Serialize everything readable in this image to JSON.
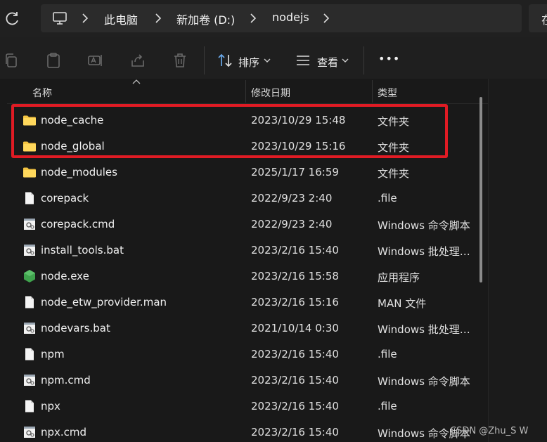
{
  "address": {
    "crumbs": [
      "此电脑",
      "新加卷 (D:)",
      "nodejs"
    ],
    "search_stub": "在"
  },
  "toolbar": {
    "sort_label": "排序",
    "view_label": "查看",
    "more_label": "•••"
  },
  "columns": {
    "name": "名称",
    "date": "修改日期",
    "type": "类型"
  },
  "files": [
    {
      "name": "node_cache",
      "date": "2023/10/29 15:48",
      "type": "文件夹",
      "icon": "folder-icon"
    },
    {
      "name": "node_global",
      "date": "2023/10/29 15:16",
      "type": "文件夹",
      "icon": "folder-icon"
    },
    {
      "name": "node_modules",
      "date": "2025/1/17 16:59",
      "type": "文件夹",
      "icon": "folder-icon"
    },
    {
      "name": "corepack",
      "date": "2022/9/23 2:40",
      "type": ".file",
      "icon": "file-icon"
    },
    {
      "name": "corepack.cmd",
      "date": "2022/9/23 2:40",
      "type": "Windows 命令脚本",
      "icon": "script-file-icon"
    },
    {
      "name": "install_tools.bat",
      "date": "2023/2/16 15:40",
      "type": "Windows 批处理…",
      "icon": "script-file-icon"
    },
    {
      "name": "node.exe",
      "date": "2023/2/16 15:58",
      "type": "应用程序",
      "icon": "node-exe-icon"
    },
    {
      "name": "node_etw_provider.man",
      "date": "2023/2/16 15:16",
      "type": "MAN 文件",
      "icon": "file-icon"
    },
    {
      "name": "nodevars.bat",
      "date": "2021/10/14 0:30",
      "type": "Windows 批处理…",
      "icon": "script-file-icon"
    },
    {
      "name": "npm",
      "date": "2023/2/16 15:40",
      "type": ".file",
      "icon": "file-icon"
    },
    {
      "name": "npm.cmd",
      "date": "2023/2/16 15:40",
      "type": "Windows 命令脚本",
      "icon": "script-file-icon"
    },
    {
      "name": "npx",
      "date": "2023/2/16 15:40",
      "type": ".file",
      "icon": "file-icon"
    },
    {
      "name": "npx.cmd",
      "date": "2023/2/16 15:40",
      "type": "Windows 命令脚本",
      "icon": "script-file-icon"
    }
  ],
  "watermark": "CSDN @Zhu_S W",
  "colors": {
    "highlight": "#e01b24",
    "folder": "#f5c542",
    "node_green": "#3fa34d"
  }
}
